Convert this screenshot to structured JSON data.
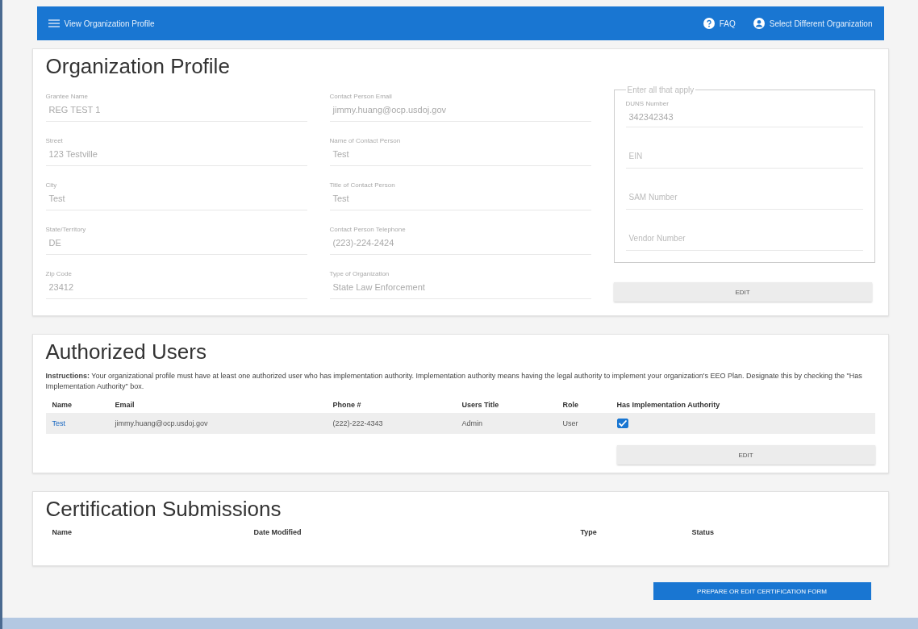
{
  "top_bar": {
    "title": "View Organization Profile",
    "faq": "FAQ",
    "select_org": "Select Different Organization"
  },
  "profile": {
    "title": "Organization Profile",
    "column_1": [
      {
        "label": "Grantee Name",
        "value": "REG TEST 1"
      },
      {
        "label": "Street",
        "value": "123 Testville"
      },
      {
        "label": "City",
        "value": "Test"
      },
      {
        "label": "State/Territory",
        "value": "DE"
      },
      {
        "label": "Zip Code",
        "value": "23412"
      }
    ],
    "column_2": [
      {
        "label": "Contact Person Email",
        "value": "jimmy.huang@ocp.usdoj.gov"
      },
      {
        "label": "Name of Contact Person",
        "value": "Test"
      },
      {
        "label": "Title of Contact Person",
        "value": "Test"
      },
      {
        "label": "Contact Person Telephone",
        "value": "(223)-224-2424"
      },
      {
        "label": "Type of Organization",
        "value": "State Law Enforcement"
      }
    ],
    "ids": {
      "legend": "Enter all that apply",
      "fields": [
        {
          "label": "DUNS Number",
          "value": "342342343"
        },
        {
          "label": "EIN"
        },
        {
          "label": "SAM Number"
        },
        {
          "label": "Vendor Number"
        }
      ]
    },
    "edit_button": "EDIT"
  },
  "users": {
    "title": "Authorized Users",
    "instructions": "**Instructions:** Your organizational profile must have at least one authorized user who has implementation authority. Implementation authority means having the legal authority to implement your organization's EEO Plan. Designate this by checking the \"Has Implementation Authority\" box.",
    "columns": [
      "Name",
      "Email",
      "Phone #",
      "Users Title",
      "Role",
      "Has Implementation Authority"
    ],
    "rows": [
      {
        "name": "Test",
        "email": "jimmy.huang@ocp.usdoj.gov",
        "phone": "(222)-222-4343",
        "title": "Admin",
        "role": "User",
        "has_authority": true
      }
    ],
    "edit_button": "EDIT"
  },
  "certifications": {
    "title": "Certification Submissions",
    "columns": [
      "Name",
      "Date Modified",
      "Type",
      "Status"
    ]
  },
  "prepare_button": "PREPARE OR EDIT CERTIFICATION FORM"
}
